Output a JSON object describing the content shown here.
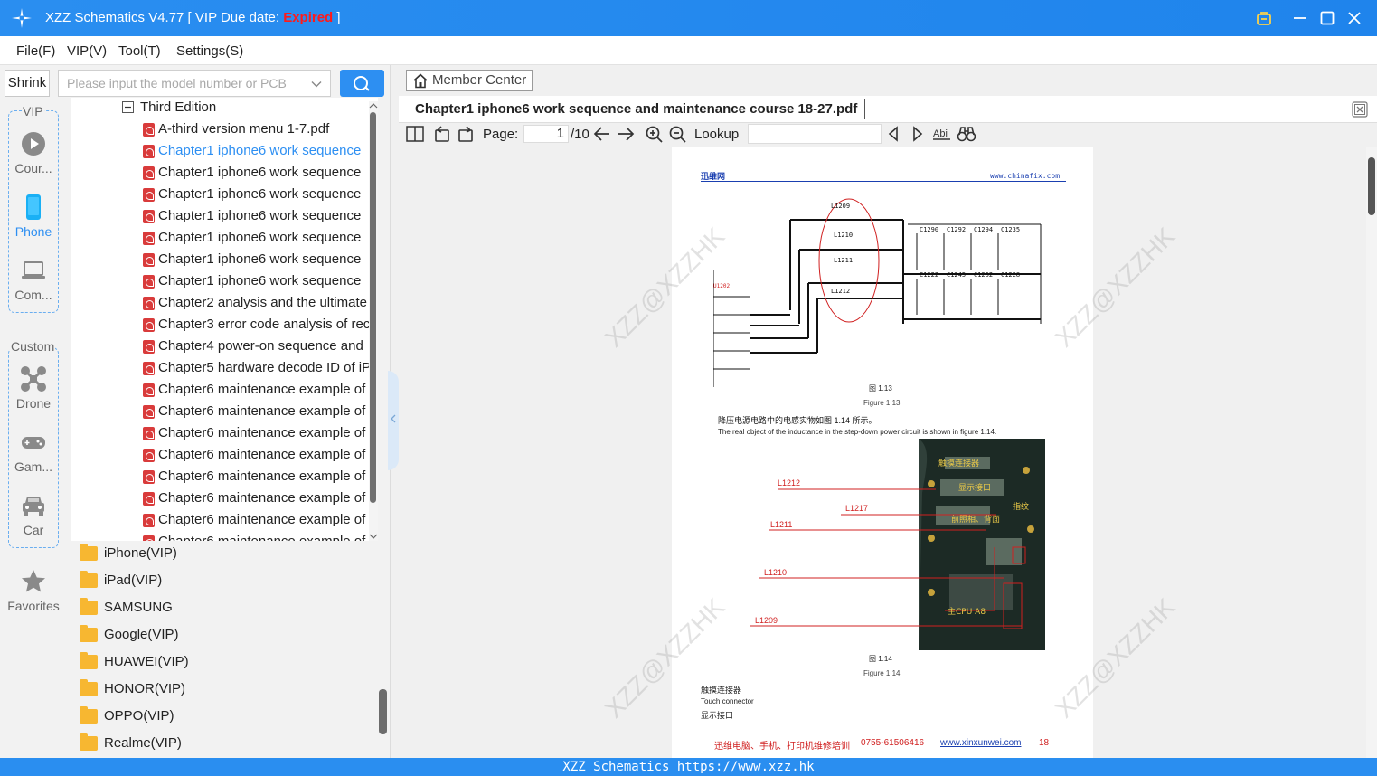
{
  "window": {
    "title": "XZZ Schematics V4.77 [ VIP Due date: ",
    "title_expired": "Expired",
    "title_end": " ]"
  },
  "menu": [
    "File(F)",
    "VIP(V)",
    "Tool(T)",
    "Settings(S)"
  ],
  "left": {
    "shrink_label": "Shrink",
    "search_placeholder": "Please input the model number or PCB",
    "vip_label": "VIP",
    "custom_label": "Custom",
    "vip_categories": [
      "Cour...",
      "Phone",
      "Com..."
    ],
    "custom_categories": [
      "Drone",
      "Gam...",
      "Car"
    ],
    "favorites_label": "Favorites"
  },
  "tree": {
    "parent": "Third Edition",
    "items": [
      "A-third version menu  1-7.pdf",
      "Chapter1 iphone6 work sequence",
      "Chapter1 iphone6 work sequence",
      "Chapter1 iphone6 work sequence",
      "Chapter1 iphone6 work sequence",
      "Chapter1 iphone6 work sequence",
      "Chapter1 iphone6 work sequence",
      "Chapter1 iphone6 work sequence",
      "Chapter2 analysis and the ultimate",
      "Chapter3 error code analysis of rec",
      "Chapter4 power-on sequence and",
      "Chapter5 hardware decode ID of iP",
      "Chapter6 maintenance example of",
      "Chapter6 maintenance example of",
      "Chapter6 maintenance example of",
      "Chapter6 maintenance example of",
      "Chapter6 maintenance example of",
      "Chapter6 maintenance example of",
      "Chapter6 maintenance example of",
      "Chapter6 maintenance example of"
    ],
    "selected_index": 1
  },
  "folders": [
    "iPhone(VIP)",
    "iPad(VIP)",
    "SAMSUNG",
    "Google(VIP)",
    "HUAWEI(VIP)",
    "HONOR(VIP)",
    "OPPO(VIP)",
    "Realme(VIP)"
  ],
  "viewer": {
    "member_center": "Member Center",
    "doc_title": "Chapter1 iphone6 work sequence and maintenance course  18-27.pdf",
    "page_label": "Page:",
    "page_value": "1",
    "page_total": "/10",
    "lookup_label": "Lookup"
  },
  "pdf": {
    "header_left": "迅维网",
    "header_right": "www.chinafix.com",
    "fig1_cn": "图 1.13",
    "fig1_en": "Figure 1.13",
    "para_cn": "降压电源电路中的电感实物如图 1.14 所示。",
    "para_en": "The real object of the inductance in the step-down power circuit is shown in figure 1.14.",
    "fig2_cn": "图 1.14",
    "fig2_en": "Figure 1.14",
    "touch_cn": "触摸连接器",
    "touch_en": "Touch connector",
    "display_cn": "显示接口",
    "footer_cn": "迅维电脑、手机、打印机维修培训",
    "footer_phone": "0755-61506416",
    "footer_url": "www.xinxunwei.com",
    "footer_page": "18",
    "watermark": "XZZ@XZZHK",
    "photo_labels": [
      "L1212",
      "L1217",
      "L1211",
      "L1210",
      "L1209"
    ],
    "photo_cn": [
      "触摸连接器",
      "显示接口",
      "前照相、背面",
      "指纹",
      "主CPU A8"
    ],
    "schem_labels": [
      "L1209",
      "L1210",
      "L1211",
      "L1212",
      "U1202"
    ],
    "schem_caps": [
      "C1290",
      "C1292",
      "C1294",
      "C1235",
      "C1222",
      "C1245",
      "C1262",
      "C1228"
    ]
  },
  "status": "XZZ Schematics https://www.xzz.hk",
  "colors": {
    "accent": "#2d8ff2",
    "titlebar": "#2a8ef0",
    "expired": "#ff1a1a",
    "pdf_icon": "#d93b3b",
    "folder": "#f7b731"
  }
}
